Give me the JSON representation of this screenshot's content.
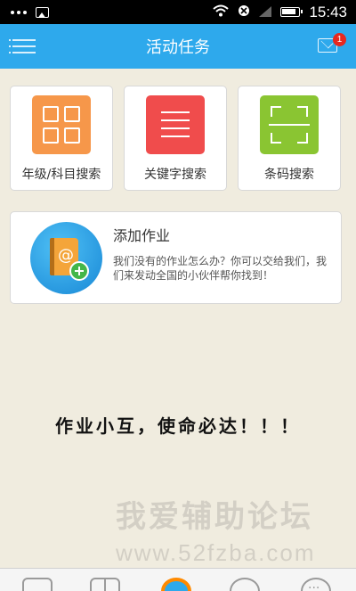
{
  "status_bar": {
    "time": "15:43"
  },
  "header": {
    "title": "活动任务",
    "mail_badge": "1"
  },
  "search_cards": [
    {
      "label": "年级/科目搜索",
      "icon": "grid-icon",
      "color": "#f6974a"
    },
    {
      "label": "关键字搜索",
      "icon": "list-icon",
      "color": "#f04c4c"
    },
    {
      "label": "条码搜索",
      "icon": "barcode-scan-icon",
      "color": "#8ac532"
    }
  ],
  "add_homework": {
    "title": "添加作业",
    "description": "我们没有的作业怎么办？你可以交给我们，我们来发动全国的小伙伴帮你找到！"
  },
  "slogan": "作业小互，使命必达！！！",
  "watermark": {
    "cn": "我爱辅助论坛",
    "url": "www.52fzba.com"
  },
  "colors": {
    "header": "#2ea9ec",
    "background": "#f0ecdf",
    "badge": "#e8281f"
  }
}
